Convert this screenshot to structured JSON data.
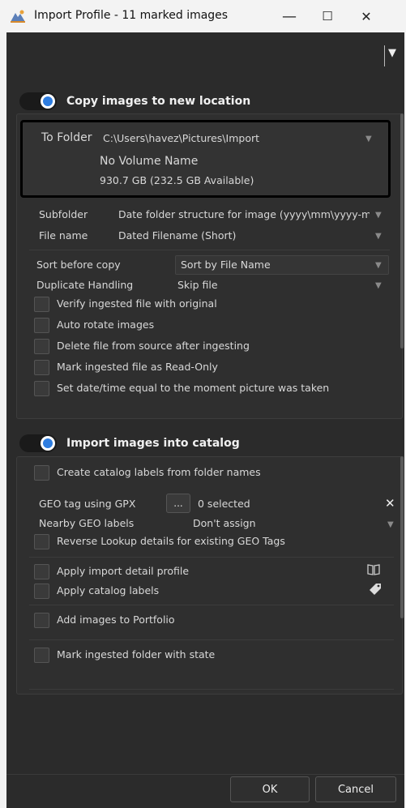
{
  "window": {
    "title": "Import Profile - 11 marked images",
    "minimize": "—",
    "maximize": "☐",
    "close": "✕"
  },
  "topbar": {
    "menu_arrow": "▼"
  },
  "copy_section": {
    "title": "Copy images to new location",
    "toggle_on": true,
    "to_folder_label": "To Folder",
    "to_folder_path": "C:\\Users\\havez\\Pictures\\Import",
    "volume_name": "No Volume Name",
    "volume_size": "930.7 GB (232.5 GB Available)",
    "subfolder_label": "Subfolder",
    "subfolder_value": "Date folder structure for image (yyyy\\mm\\yyyy-mr",
    "filename_label": "File name",
    "filename_value": "Dated Filename (Short)",
    "sort_label": "Sort before copy",
    "sort_value": "Sort by File Name",
    "duplicate_label": "Duplicate Handling",
    "duplicate_value": "Skip file",
    "options": [
      "Verify ingested file with original",
      "Auto rotate images",
      "Delete file from source after ingesting",
      "Mark ingested file as Read-Only",
      "Set date/time equal to the moment picture was taken"
    ]
  },
  "catalog_section": {
    "title": "Import images into catalog",
    "toggle_on": true,
    "create_labels": "Create catalog labels from folder names",
    "geo_label": "GEO tag using GPX",
    "geo_button": "...",
    "geo_selected": "0 selected",
    "geo_clear": "✕",
    "nearby_label": "Nearby GEO labels",
    "nearby_value": "Don't assign",
    "reverse_lookup": "Reverse Lookup details for existing GEO Tags",
    "apply_profile": "Apply import detail profile",
    "apply_labels": "Apply catalog labels",
    "add_portfolio": "Add images to Portfolio",
    "mark_folder": "Mark ingested folder with state"
  },
  "footer": {
    "ok": "OK",
    "cancel": "Cancel"
  }
}
